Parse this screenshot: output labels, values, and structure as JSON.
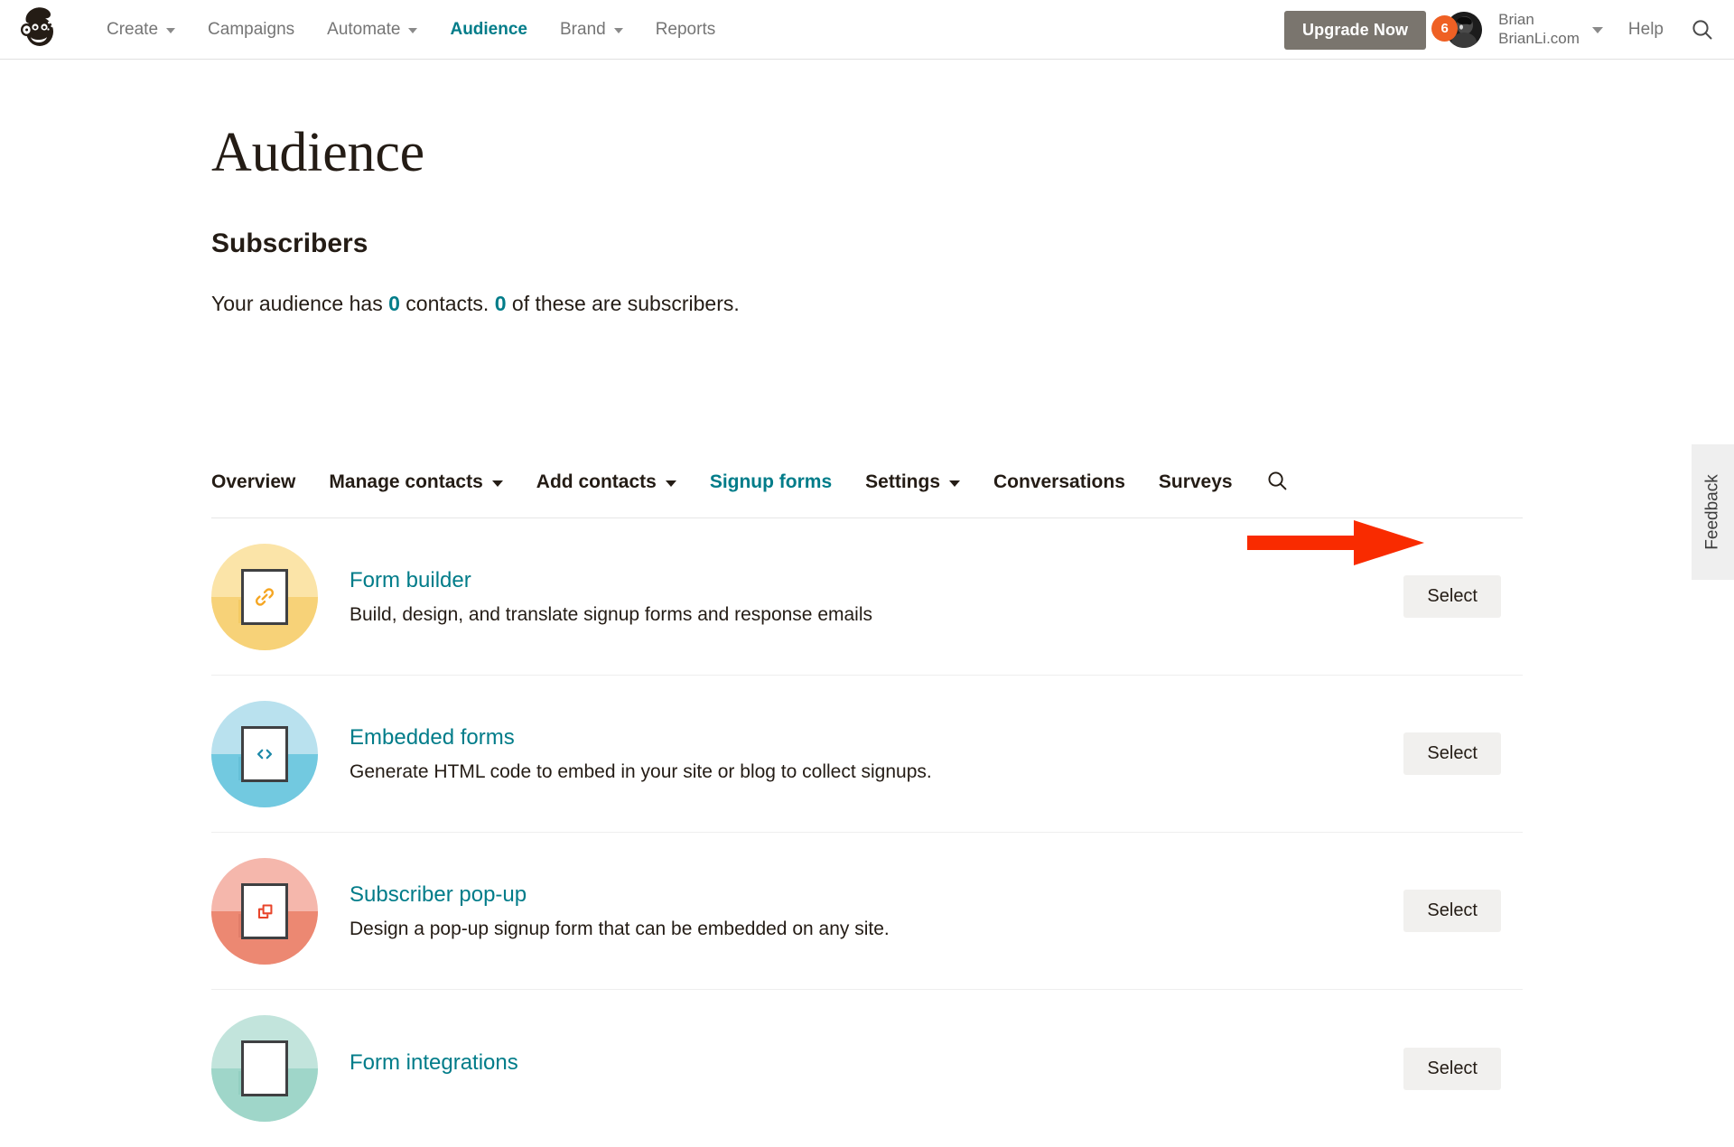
{
  "topnav": {
    "logo_name": "mailchimp-freddie-logo",
    "items": [
      {
        "label": "Create",
        "caret": true,
        "active": false
      },
      {
        "label": "Campaigns",
        "caret": false,
        "active": false
      },
      {
        "label": "Automate",
        "caret": true,
        "active": false
      },
      {
        "label": "Audience",
        "caret": false,
        "active": true
      },
      {
        "label": "Brand",
        "caret": true,
        "active": false
      },
      {
        "label": "Reports",
        "caret": false,
        "active": false
      }
    ],
    "upgrade_label": "Upgrade Now",
    "badge_count": "6",
    "account_name": "Brian",
    "account_site": "BrianLi.com",
    "help_label": "Help",
    "search_icon": "search-icon",
    "accent_teal": "#007c89",
    "badge_color": "#ef6024",
    "upgrade_bg": "#7a756e"
  },
  "page": {
    "title": "Audience",
    "subtitle": "Subscribers",
    "desc_pre": "Your audience has ",
    "desc_contacts_count": "0",
    "desc_mid": " contacts. ",
    "desc_subs_count": "0",
    "desc_post": " of these are subscribers."
  },
  "tabs": [
    {
      "label": "Overview",
      "caret": false,
      "active": false
    },
    {
      "label": "Manage contacts",
      "caret": true,
      "active": false
    },
    {
      "label": "Add contacts",
      "caret": true,
      "active": false
    },
    {
      "label": "Signup forms",
      "caret": false,
      "active": true
    },
    {
      "label": "Settings",
      "caret": true,
      "active": false
    },
    {
      "label": "Conversations",
      "caret": false,
      "active": false
    },
    {
      "label": "Surveys",
      "caret": false,
      "active": false
    }
  ],
  "tab_search_icon": "search-icon",
  "rows": [
    {
      "title": "Form builder",
      "desc": "Build, design, and translate signup forms and response emails",
      "select_label": "Select",
      "icon_name": "link-chain-icon",
      "circle_top": "#fbe4a8",
      "circle_bottom": "#f7d278",
      "glyph_color": "#f5a623"
    },
    {
      "title": "Embedded forms",
      "desc": "Generate HTML code to embed in your site or blog to collect signups.",
      "select_label": "Select",
      "icon_name": "code-brackets-icon",
      "circle_top": "#b9e1ee",
      "circle_bottom": "#72c9e0",
      "glyph_color": "#1d89a8"
    },
    {
      "title": "Subscriber pop-up",
      "desc": "Design a pop-up signup form that can be embedded on any site.",
      "select_label": "Select",
      "icon_name": "popup-windows-icon",
      "circle_top": "#f5b7ac",
      "circle_bottom": "#ec8872",
      "glyph_color": "#e8442a"
    },
    {
      "title": "Form integrations",
      "desc": "",
      "select_label": "Select",
      "icon_name": "integrations-icon",
      "circle_top": "#c2e4dc",
      "circle_bottom": "#9fd6c9",
      "glyph_color": "#3c9c8a"
    }
  ],
  "annotation": {
    "arrow_name": "red-pointer-arrow",
    "arrow_color": "#f92b00",
    "points_to": "Select"
  },
  "feedback": {
    "label": "Feedback"
  }
}
